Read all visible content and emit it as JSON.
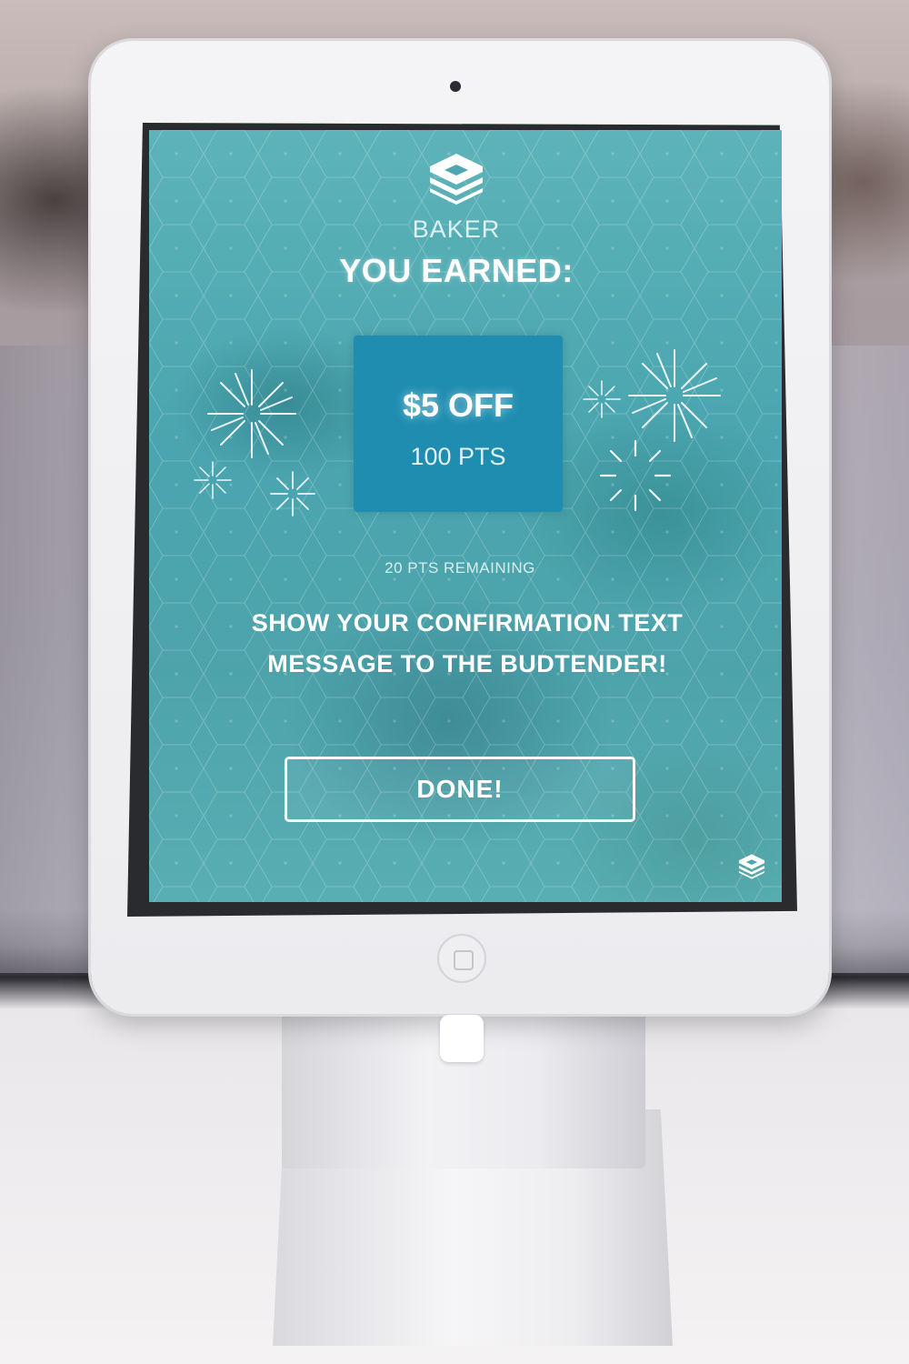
{
  "brand": {
    "name": "BAKER",
    "logo_icon": "baker-cube-logo-icon"
  },
  "screen": {
    "headline": "YOU EARNED:",
    "reward": {
      "amount": "$5 OFF",
      "points": "100 PTS"
    },
    "remaining": "20 PTS REMAINING",
    "instruction": "SHOW YOUR CONFIRMATION TEXT MESSAGE TO THE BUDTENDER!",
    "done_button": "DONE!"
  },
  "colors": {
    "screen_background": "#4ea7b0",
    "reward_card": "#1f8db0",
    "text": "#ffffff"
  },
  "device": {
    "type": "tablet kiosk",
    "home_button_icon": "home-button-icon"
  }
}
